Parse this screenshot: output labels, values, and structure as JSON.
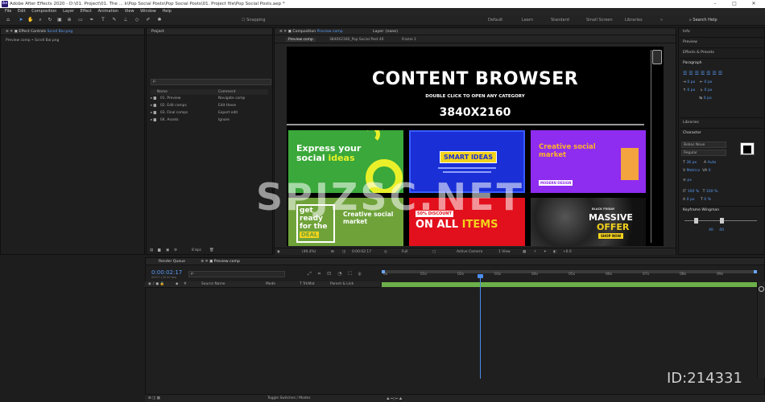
{
  "window": {
    "title": "Adobe After Effects 2020 - D:\\01. Project\\01. The ... k\\Pop Social Posts\\Pop Social Posts\\01. Project file\\Pop Social Posts.aep *",
    "logo": "Ae",
    "controls": [
      "–",
      "□",
      "✕"
    ]
  },
  "menu": [
    "File",
    "Edit",
    "Composition",
    "Layer",
    "Effect",
    "Animation",
    "View",
    "Window",
    "Help"
  ],
  "toolbar": {
    "snapping": "Snapping",
    "workspaces": [
      "Default",
      "Learn",
      "Standard",
      "Small Screen",
      "Libraries"
    ],
    "search_help": "Search Help"
  },
  "effect_controls": {
    "tab": "Effect Controls",
    "tab_target": "Scroll Bar.png",
    "breadcrumb": "Preview comp • Scroll Bar.png"
  },
  "project": {
    "tab": "Project",
    "search_placeholder": "ρ.",
    "columns": [
      "Name",
      "Comment"
    ],
    "items": [
      {
        "name": "01. Preview",
        "comment": "Navigate comp"
      },
      {
        "name": "02. Edit comps",
        "comment": "Edit these"
      },
      {
        "name": "03. Final comps",
        "comment": "Export edit"
      },
      {
        "name": "04. Assets",
        "comment": "Ignore"
      }
    ],
    "footer_bpc": "8 bpc"
  },
  "composition": {
    "tab_prefix": "Composition",
    "tab_name": "Preview comp",
    "layer_tab": "Layer: (none)",
    "subtabs": [
      "Preview comp",
      "3840X2160_Pop Social Post 46",
      "Frame 1"
    ],
    "heading": "CONTENT BROWSER",
    "subheading": "DOUBLE CLICK TO OPEN  ANY CATEGORY",
    "resolution": "3840X2160",
    "tiles": [
      {
        "line1": "Express your",
        "line2": "social",
        "highlight": "ideas"
      },
      {
        "label": "SMART IDEAS"
      },
      {
        "line1": "Creative social",
        "line2": "market",
        "badge": "MODERN DESIGN"
      },
      {
        "line1": "get",
        "line2": "ready",
        "line3": "for the",
        "highlight": "DEAL",
        "side1": "Creative social",
        "side2": "market"
      },
      {
        "badge": "50% DISCOUNT",
        "line1": "ON ALL",
        "highlight": "ITEMS"
      },
      {
        "small": "BLACK FRIDAY",
        "line1": "MASSIVE",
        "line2": "OFFER",
        "button": "SHOP NOW"
      }
    ],
    "viewer": {
      "zoom": "(49.4%)",
      "timecode": "0:00:02:17",
      "resolution": "Full",
      "camera": "Active Camera",
      "views": "1 View",
      "exposure": "+0.0"
    }
  },
  "right_panels": {
    "items_top": [
      "Info",
      "Preview",
      "Effects & Presets"
    ],
    "paragraph": "Paragraph",
    "paragraph_values": [
      "0 px",
      "0 px",
      "0 px",
      "0 px",
      "0 px"
    ],
    "libraries": "Libraries",
    "character": "Character",
    "font_name": "Bebas Neue",
    "font_style": "Regular",
    "char_values": [
      "36 px",
      "Auto",
      "Metrics",
      "0",
      "px",
      "100 %",
      "100 %",
      "0 px",
      "0 %"
    ],
    "keyframe": "Keyframe Wingman",
    "keyframe_values": [
      "40",
      "40"
    ]
  },
  "timeline": {
    "tabs": [
      "Render Queue",
      "Preview comp"
    ],
    "timecode": "0:00:02:17",
    "frame_info": "00077 (30.00 fps)",
    "columns": [
      "#",
      "Source Name",
      "Mode",
      "T TrkMat",
      "Parent & Link"
    ],
    "ruler": [
      "0s",
      "01s",
      "02s",
      "03s",
      "04s",
      "05s",
      "06s",
      "07s",
      "08s",
      "09s"
    ],
    "playhead_seconds": 2.57,
    "footer": "Toggle Switches / Modes"
  },
  "overlay": {
    "watermark": "SPJZSC.NET",
    "id": "ID:214331"
  }
}
